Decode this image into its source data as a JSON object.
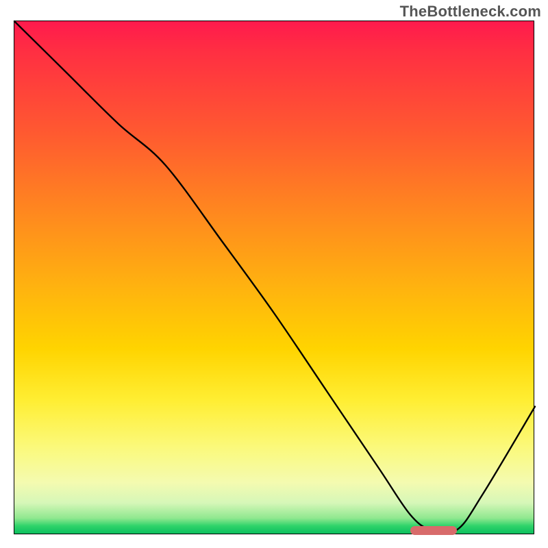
{
  "watermark": "TheBottleneck.com",
  "colors": {
    "gradient_top": "#ff1a4d",
    "gradient_mid1": "#ff8a1e",
    "gradient_mid2": "#ffee33",
    "gradient_bottom": "#0cbf5e",
    "curve_stroke": "#000000",
    "capsule": "#d86b6b",
    "border": "#000000",
    "watermark_text": "#555555"
  },
  "chart_data": {
    "type": "line",
    "title": "",
    "xlabel": "",
    "ylabel": "",
    "xlim": [
      0,
      100
    ],
    "ylim": [
      0,
      100
    ],
    "legend": false,
    "grid": false,
    "series": [
      {
        "name": "bottleneck-curve",
        "x": [
          0,
          10,
          20,
          29,
          40,
          50,
          60,
          70,
          76,
          80,
          85,
          90,
          100
        ],
        "values": [
          100,
          90,
          80,
          72,
          57,
          43,
          28,
          13,
          4,
          1,
          1,
          8,
          25
        ],
        "note": "visual estimate from gradient plot; y is height above bottom as percent"
      }
    ],
    "annotations": [
      {
        "type": "capsule",
        "x_range_pct": [
          76,
          85
        ],
        "y_pct": 1,
        "color": "#d86b6b"
      },
      {
        "type": "watermark",
        "text": "TheBottleneck.com",
        "position": "top-right"
      }
    ]
  }
}
